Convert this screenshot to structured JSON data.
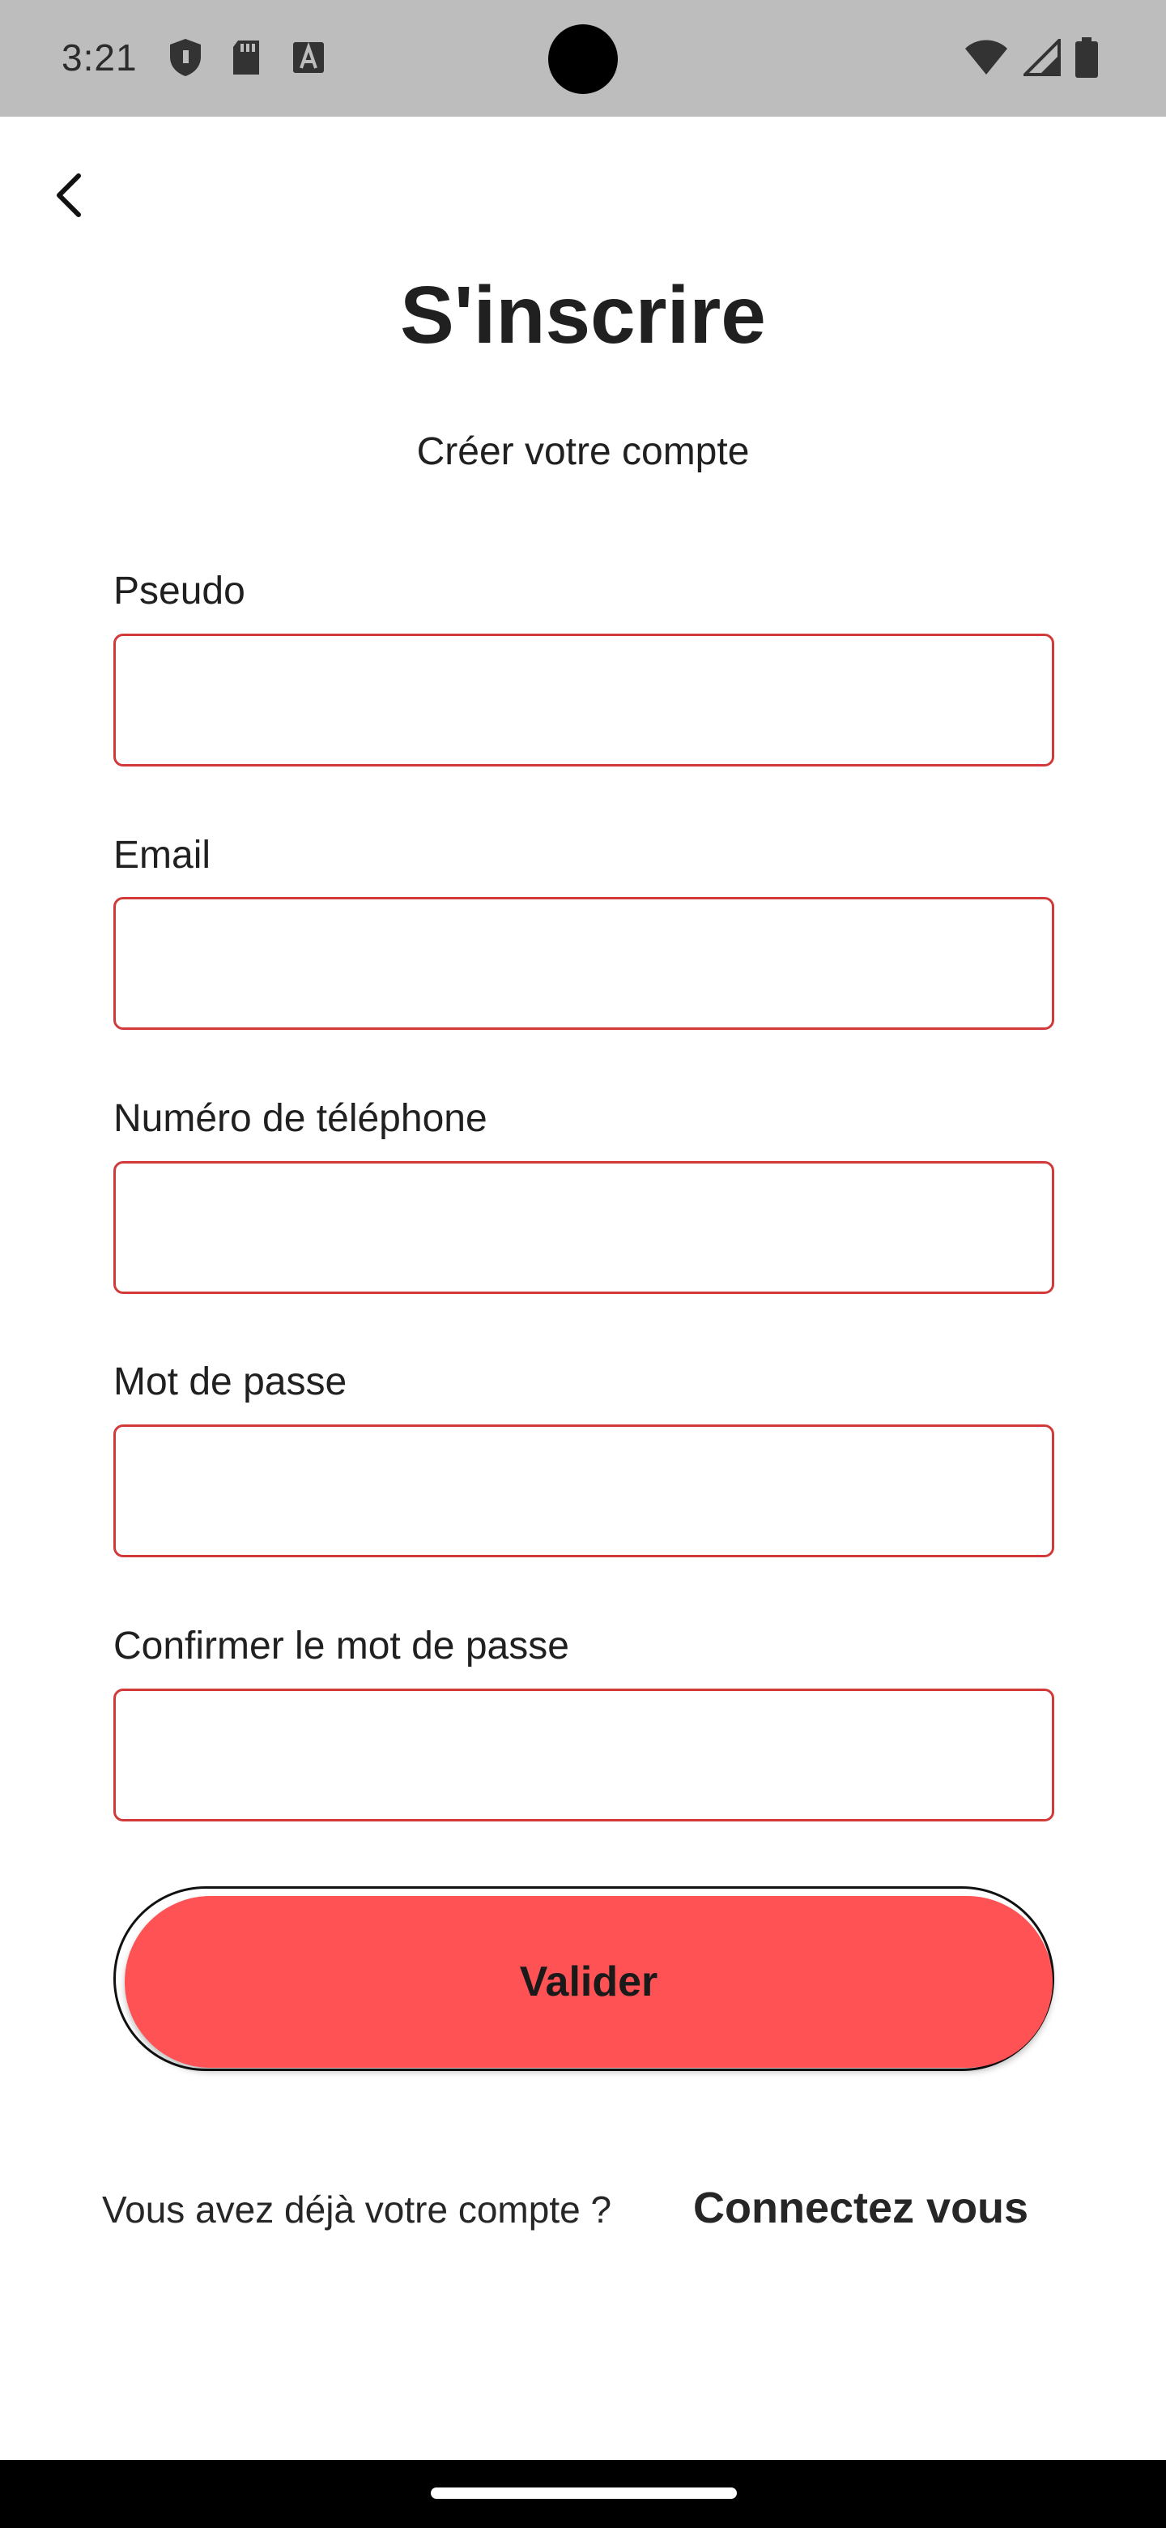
{
  "status_bar": {
    "time": "3:21",
    "left_icons": [
      "shield-icon",
      "sd-card-icon",
      "font-a-icon"
    ],
    "right_icons": [
      "wifi-icon",
      "signal-icon",
      "battery-icon"
    ]
  },
  "header": {
    "back_icon": "chevron-left-icon",
    "title": "S'inscrire",
    "subtitle": "Créer votre compte"
  },
  "form": {
    "fields": [
      {
        "label": "Pseudo",
        "value": ""
      },
      {
        "label": "Email",
        "value": ""
      },
      {
        "label": "Numéro de téléphone",
        "value": ""
      },
      {
        "label": "Mot de passe",
        "value": ""
      },
      {
        "label": "Confirmer le mot de passe",
        "value": ""
      }
    ],
    "submit_label": "Valider"
  },
  "footer": {
    "prompt": "Vous avez déjà votre compte ?",
    "link": "Connectez vous"
  },
  "colors": {
    "accent": "#ff5254",
    "input_border": "#d23a3a",
    "status_bar": "#bdbdbd"
  }
}
